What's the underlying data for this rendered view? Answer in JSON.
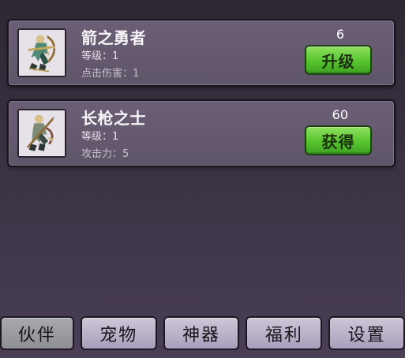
{
  "cards": [
    {
      "name": "箭之勇者",
      "level_label": "等级：1",
      "stat_label": "点击伤害：1",
      "value": "6",
      "button_label": "升级",
      "icon": "archer-portrait"
    },
    {
      "name": "长枪之士",
      "level_label": "等级：1",
      "stat_label": "攻击力：5",
      "value": "60",
      "button_label": "获得",
      "icon": "spearman-portrait"
    }
  ],
  "tabs": [
    {
      "label": "伙伴",
      "active": true
    },
    {
      "label": "宠物",
      "active": false
    },
    {
      "label": "神器",
      "active": false
    },
    {
      "label": "福利",
      "active": false
    },
    {
      "label": "设置",
      "active": false
    }
  ],
  "colors": {
    "button_green": "#57c42f",
    "card_bg": "#6b5f75",
    "tab_bg": "#cfc6d8",
    "active_tab_bg": "#a9a8ad"
  }
}
